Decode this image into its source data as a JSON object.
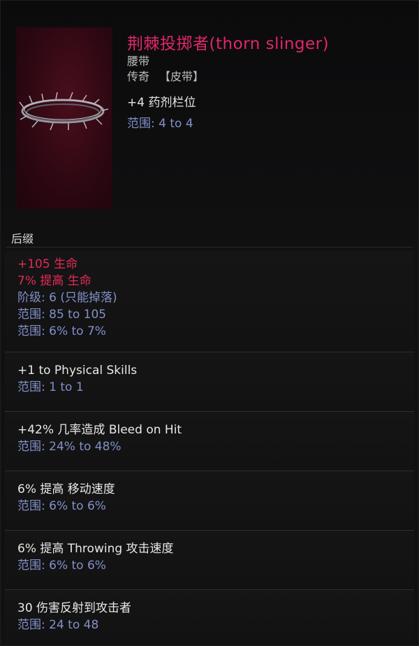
{
  "item": {
    "name": "荆棘投掷者(thorn slinger)",
    "base_type": "腰带",
    "rarity": "传奇",
    "subtype": "【皮带】",
    "icon": "thorn-ring-icon",
    "implicit": {
      "text": "+4 药剂栏位",
      "range": "范围: 4 to 4"
    }
  },
  "section": {
    "title": "后缀"
  },
  "affixes": [
    {
      "lines": [
        "+105 生命",
        "7% 提高 生命",
        "阶级: 6 (只能掉落)",
        "范围: 85 to 105",
        "范围: 6% to 7%"
      ]
    },
    {
      "lines": [
        "+1 to Physical Skills",
        "范围: 1 to 1"
      ]
    },
    {
      "lines": [
        "+42% 几率造成 Bleed on Hit",
        "范围: 24% to 48%"
      ]
    },
    {
      "lines": [
        "6% 提高 移动速度",
        "范围: 6% to 6%"
      ]
    },
    {
      "lines": [
        "6% 提高 Throwing 攻击速度",
        "范围: 6% to 6%"
      ]
    },
    {
      "lines": [
        "30 伤害反射到攻击者",
        "范围: 24 to 48"
      ]
    }
  ],
  "colors": {
    "item_name": "#e0266a",
    "highlight_stat": "#e32b54",
    "stat": "#e8e8e8",
    "range": "#8291c9",
    "portrait_bg": "#2e0812"
  }
}
